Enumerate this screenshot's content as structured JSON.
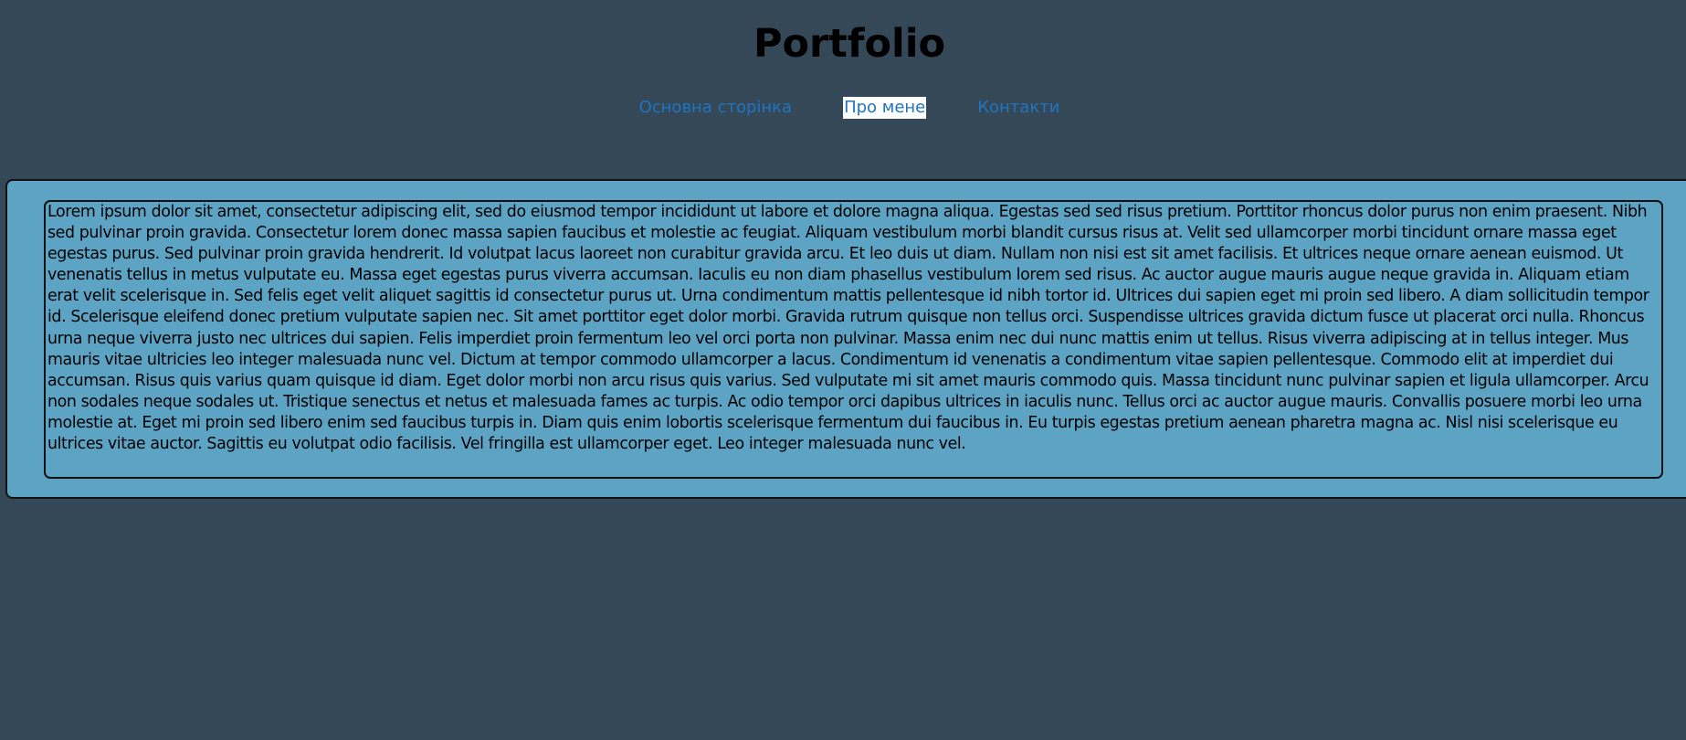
{
  "header": {
    "title": "Portfolio"
  },
  "nav": {
    "items": [
      {
        "label": "Основна сторінка",
        "active": false
      },
      {
        "label": "Про мене",
        "active": true
      },
      {
        "label": "Контакти",
        "active": false
      }
    ]
  },
  "main": {
    "text": "Lorem ipsum dolor sit amet, consectetur adipiscing elit, sed do eiusmod tempor incididunt ut labore et dolore magna aliqua. Egestas sed sed risus pretium. Porttitor rhoncus dolor purus non enim praesent. Nibh sed pulvinar proin gravida. Consectetur lorem donec massa sapien faucibus et molestie ac feugiat. Aliquam vestibulum morbi blandit cursus risus at. Velit sed ullamcorper morbi tincidunt ornare massa eget egestas purus. Sed pulvinar proin gravida hendrerit. Id volutpat lacus laoreet non curabitur gravida arcu. Et leo duis ut diam. Nullam non nisi est sit amet facilisis. Et ultrices neque ornare aenean euismod. Ut venenatis tellus in metus vulputate eu. Massa eget egestas purus viverra accumsan. Iaculis eu non diam phasellus vestibulum lorem sed risus. Ac auctor augue mauris augue neque gravida in. Aliquam etiam erat velit scelerisque in. Sed felis eget velit aliquet sagittis id consectetur purus ut. Urna condimentum mattis pellentesque id nibh tortor id. Ultrices dui sapien eget mi proin sed libero. A diam sollicitudin tempor id. Scelerisque eleifend donec pretium vulputate sapien nec. Sit amet porttitor eget dolor morbi. Gravida rutrum quisque non tellus orci. Suspendisse ultrices gravida dictum fusce ut placerat orci nulla. Rhoncus urna neque viverra justo nec ultrices dui sapien. Felis imperdiet proin fermentum leo vel orci porta non pulvinar. Massa enim nec dui nunc mattis enim ut tellus. Risus viverra adipiscing at in tellus integer. Mus mauris vitae ultricies leo integer malesuada nunc vel. Dictum at tempor commodo ullamcorper a lacus. Condimentum id venenatis a condimentum vitae sapien pellentesque. Commodo elit at imperdiet dui accumsan. Risus quis varius quam quisque id diam. Eget dolor morbi non arcu risus quis varius. Sed vulputate mi sit amet mauris commodo quis. Massa tincidunt nunc pulvinar sapien et ligula ullamcorper. Arcu non sodales neque sodales ut. Tristique senectus et netus et malesuada fames ac turpis. Ac odio tempor orci dapibus ultrices in iaculis nunc. Tellus orci ac auctor augue mauris. Convallis posuere morbi leo urna molestie at. Eget mi proin sed libero enim sed faucibus turpis in. Diam quis enim lobortis scelerisque fermentum dui faucibus in. Eu turpis egestas pretium aenean pharetra magna ac. Nisl nisi scelerisque eu ultrices vitae auctor. Sagittis eu volutpat odio facilisis. Vel fringilla est ullamcorper eget. Leo integer malesuada nunc vel."
  },
  "colors": {
    "background": "#354858",
    "panel": "#5da4c4",
    "link": "#1f74c2",
    "active_link_bg": "#ffffff",
    "border": "#111111"
  }
}
